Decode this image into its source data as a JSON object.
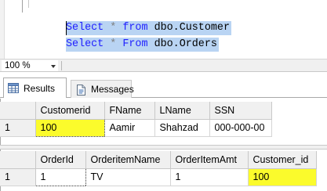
{
  "editor": {
    "lines": [
      {
        "kw1": "Select",
        "op": "*",
        "kw2": "from",
        "obj": "dbo.Customer"
      },
      {
        "kw1": "Select",
        "op": "*",
        "kw2": "From",
        "obj": "dbo.Orders"
      }
    ]
  },
  "zoom": {
    "value": "100 %"
  },
  "tabs": [
    {
      "label": "Results",
      "icon": "grid-icon"
    },
    {
      "label": "Messages",
      "icon": "document-icon"
    }
  ],
  "grid1": {
    "columns": [
      "Customerid",
      "FName",
      "LName",
      "SSN"
    ],
    "rows": [
      {
        "num": "1",
        "cells": [
          "100",
          "Aamir",
          "Shahzad",
          "000-000-00"
        ]
      }
    ]
  },
  "grid2": {
    "columns": [
      "OrderId",
      "OrderitemName",
      "OrderItemAmt",
      "Customer_id"
    ],
    "rows": [
      {
        "num": "1",
        "cells": [
          "1",
          "TV",
          "1",
          "100"
        ]
      }
    ]
  },
  "colors": {
    "selection": "#b9d4f3",
    "keyword": "#2020ff",
    "highlight": "#fbfb2c"
  }
}
